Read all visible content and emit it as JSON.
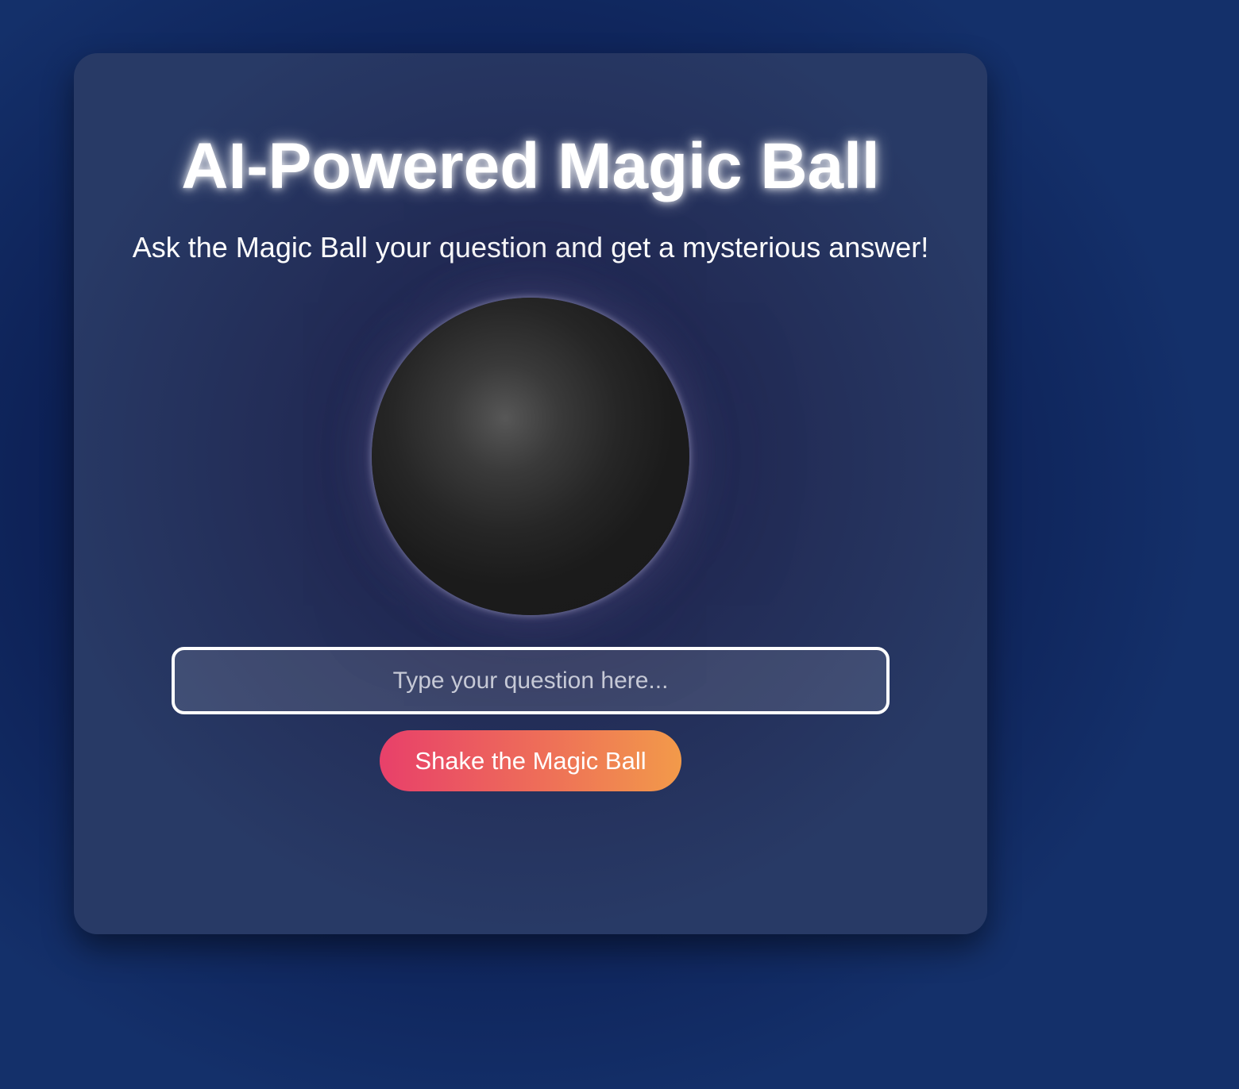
{
  "app": {
    "title": "AI-Powered Magic Ball",
    "subtitle": "Ask the Magic Ball your question and get a mysterious answer!"
  },
  "question_input": {
    "value": "",
    "placeholder": "Type your question here..."
  },
  "shake_button": {
    "label": "Shake the Magic Ball"
  },
  "colors": {
    "page_background": "#0c1e52",
    "card_background": "#222b55",
    "ball": "#1b1b1b",
    "button_gradient_start": "#e8406a",
    "button_gradient_end": "#f29a4a",
    "text": "#ffffff"
  }
}
